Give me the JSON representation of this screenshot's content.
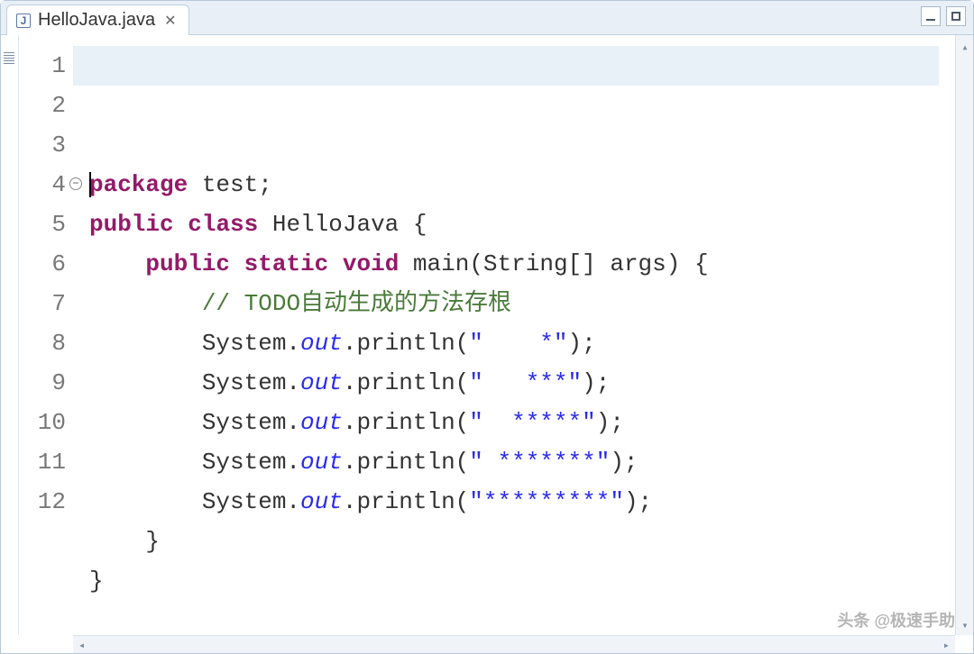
{
  "tab": {
    "filename": "HelloJava.java",
    "icon_letter": "J"
  },
  "code": {
    "lines": [
      {
        "n": 1,
        "tokens": [
          {
            "t": "package",
            "c": "kw"
          },
          {
            "t": " test;",
            "c": ""
          }
        ]
      },
      {
        "n": 2,
        "tokens": [
          {
            "t": "",
            "c": ""
          }
        ]
      },
      {
        "n": 3,
        "tokens": [
          {
            "t": "public",
            "c": "kw"
          },
          {
            "t": " ",
            "c": ""
          },
          {
            "t": "class",
            "c": "kw"
          },
          {
            "t": " HelloJava {",
            "c": ""
          }
        ]
      },
      {
        "n": 4,
        "fold": true,
        "tokens": [
          {
            "t": "    ",
            "c": ""
          },
          {
            "t": "public",
            "c": "kw"
          },
          {
            "t": " ",
            "c": ""
          },
          {
            "t": "static",
            "c": "kw"
          },
          {
            "t": " ",
            "c": ""
          },
          {
            "t": "void",
            "c": "kw"
          },
          {
            "t": " main(String[] args) {",
            "c": ""
          }
        ]
      },
      {
        "n": 5,
        "tokens": [
          {
            "t": "        ",
            "c": ""
          },
          {
            "t": "// ",
            "c": "comment"
          },
          {
            "t": "TODO自动生成的方法存根",
            "c": "comment"
          }
        ]
      },
      {
        "n": 6,
        "tokens": [
          {
            "t": "        System.",
            "c": ""
          },
          {
            "t": "out",
            "c": "field"
          },
          {
            "t": ".println(",
            "c": ""
          },
          {
            "t": "\"    *\"",
            "c": "str"
          },
          {
            "t": ");",
            "c": ""
          }
        ]
      },
      {
        "n": 7,
        "tokens": [
          {
            "t": "        System.",
            "c": ""
          },
          {
            "t": "out",
            "c": "field"
          },
          {
            "t": ".println(",
            "c": ""
          },
          {
            "t": "\"   ***\"",
            "c": "str"
          },
          {
            "t": ");",
            "c": ""
          }
        ]
      },
      {
        "n": 8,
        "tokens": [
          {
            "t": "        System.",
            "c": ""
          },
          {
            "t": "out",
            "c": "field"
          },
          {
            "t": ".println(",
            "c": ""
          },
          {
            "t": "\"  *****\"",
            "c": "str"
          },
          {
            "t": ");",
            "c": ""
          }
        ]
      },
      {
        "n": 9,
        "tokens": [
          {
            "t": "        System.",
            "c": ""
          },
          {
            "t": "out",
            "c": "field"
          },
          {
            "t": ".println(",
            "c": ""
          },
          {
            "t": "\" *******\"",
            "c": "str"
          },
          {
            "t": ");",
            "c": ""
          }
        ]
      },
      {
        "n": 10,
        "tokens": [
          {
            "t": "        System.",
            "c": ""
          },
          {
            "t": "out",
            "c": "field"
          },
          {
            "t": ".println(",
            "c": ""
          },
          {
            "t": "\"*********\"",
            "c": "str"
          },
          {
            "t": ");",
            "c": ""
          }
        ]
      },
      {
        "n": 11,
        "tokens": [
          {
            "t": "    }",
            "c": ""
          }
        ]
      },
      {
        "n": 12,
        "tokens": [
          {
            "t": "}",
            "c": ""
          }
        ]
      }
    ]
  },
  "watermark": "头条 @极速手助"
}
